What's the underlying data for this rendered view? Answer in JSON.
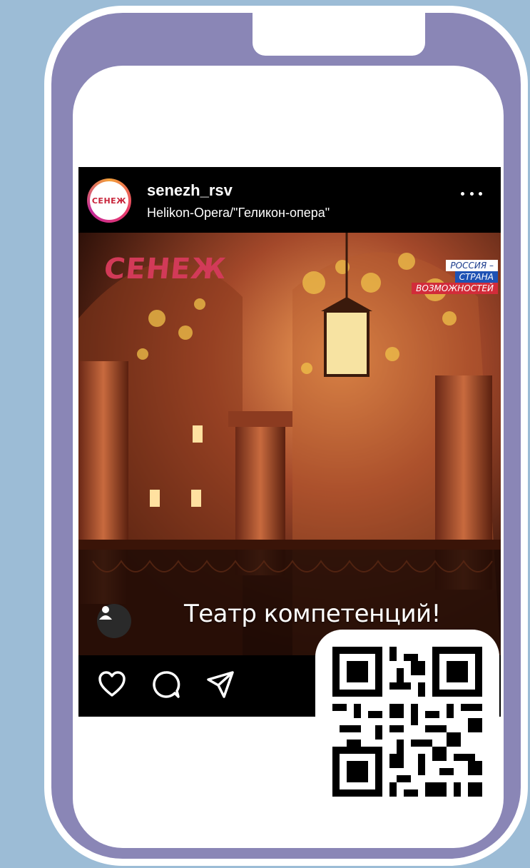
{
  "post": {
    "username": "senezh_rsv",
    "location": "Helikon-Opera/\"Геликон-опера\"",
    "avatar_text": "СЕНЕЖ",
    "more_icon": "more-horizontal-icon"
  },
  "media": {
    "logo": "СЕНЕЖ",
    "badge_line1": "РОССИЯ –",
    "badge_line2": "СТРАНА",
    "badge_line3": "ВОЗМОЖНОСТЕЙ",
    "caption": "Театр компетенций!",
    "user_tag_icon": "person-icon"
  },
  "actions": {
    "like_icon": "heart-icon",
    "comment_icon": "comment-icon",
    "share_icon": "send-icon"
  },
  "qr": {
    "icon": "qr-code-icon"
  },
  "colors": {
    "background": "#9cbcd6",
    "phone_frame": "#8a86b6",
    "brand_red": "#d23a58"
  }
}
